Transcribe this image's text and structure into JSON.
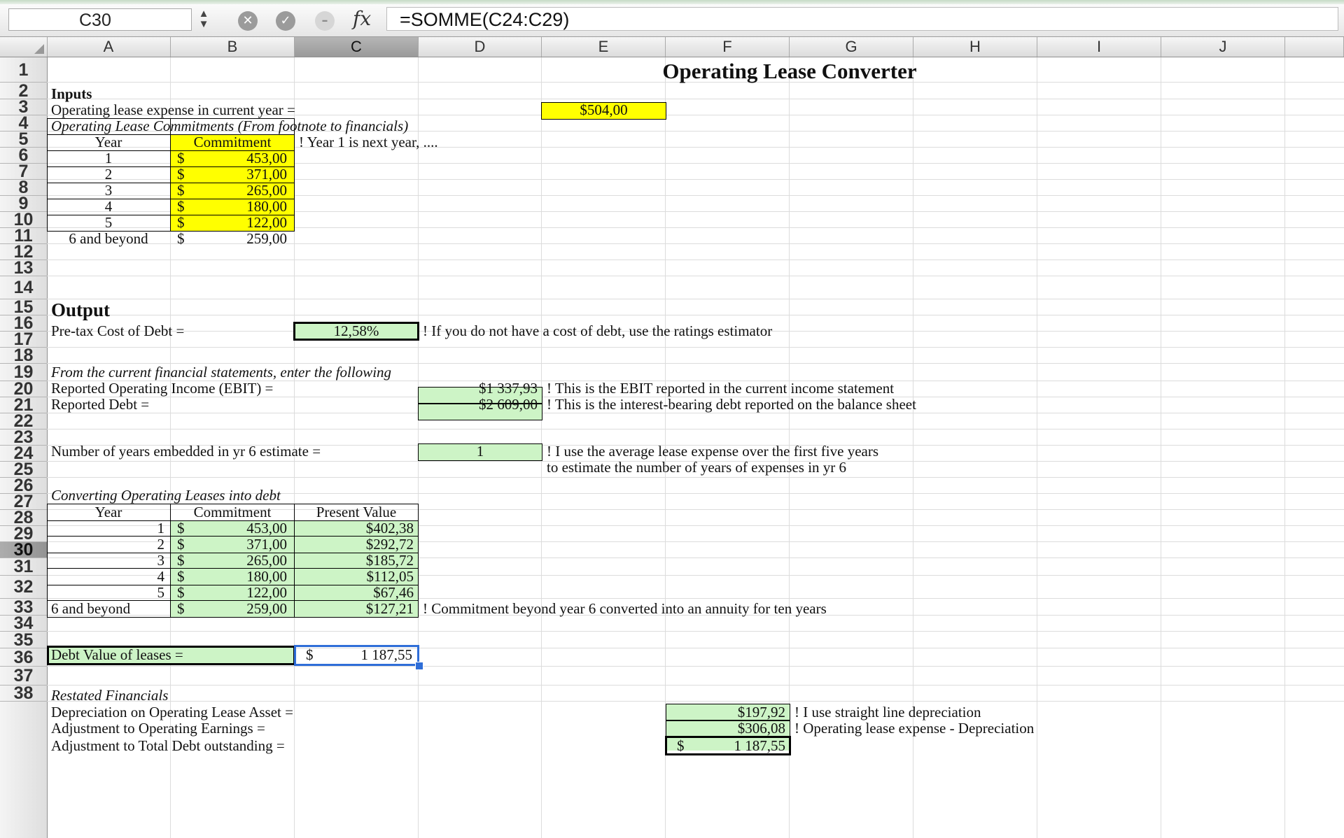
{
  "name_box": "C30",
  "stepper": {
    "up": "▲",
    "down": "▼"
  },
  "icons": {
    "cancel": "✕",
    "confirm": "✓",
    "gray": "–"
  },
  "fx_label": "fx",
  "formula": "=SOMME(C24:C29)",
  "columns": [
    "A",
    "B",
    "C",
    "D",
    "E",
    "F",
    "G",
    "H",
    "I",
    "J"
  ],
  "rows": [
    "1",
    "2",
    "3",
    "4",
    "5",
    "6",
    "7",
    "8",
    "9",
    "10",
    "11",
    "12",
    "13",
    "14",
    "15",
    "16",
    "17",
    "18",
    "19",
    "20",
    "21",
    "22",
    "23",
    "24",
    "25",
    "26",
    "27",
    "28",
    "29",
    "30",
    "31",
    "32",
    "33",
    "34",
    "35",
    "36",
    "37",
    "38"
  ],
  "selected_row": "30",
  "selected_col": "C",
  "sheet": {
    "title": "Operating Lease Converter",
    "inputs_label": "Inputs",
    "op_lease_label": "Operating lease expense in current year =",
    "op_lease_value": "$504,00",
    "commitments_label": "Operating Lease Commitments (From footnote to financials)",
    "year_hdr": "Year",
    "commitment_hdr": "Commitment",
    "pv_hdr": "Present Value",
    "year1_note": "! Year 1 is next year, ....",
    "dollar": "$",
    "inputs_table": [
      {
        "year": "1",
        "amount": "453,00"
      },
      {
        "year": "2",
        "amount": "371,00"
      },
      {
        "year": "3",
        "amount": "265,00"
      },
      {
        "year": "4",
        "amount": "180,00"
      },
      {
        "year": "5",
        "amount": "122,00"
      },
      {
        "year": "6 and beyond",
        "amount": "259,00"
      }
    ],
    "output_label": "Output",
    "pretax_label": "Pre-tax Cost of Debt =",
    "pretax_value": "12,58%",
    "pretax_note": "! If you do not have a cost of debt, use the ratings estimator",
    "current_fin_label": "From the current financial statements, enter the following",
    "ebit_label": "Reported Operating Income (EBIT) =",
    "ebit_value": "$1 337,93",
    "ebit_note": "! This is the EBIT reported in the current income statement",
    "debt_label": "Reported Debt =",
    "debt_value": "$2 609,00",
    "debt_note": "! This is the interest-bearing debt reported on the balance sheet",
    "years_label": "Number of years embedded in yr 6 estimate =",
    "years_value": "1",
    "years_note1": "! I use the average lease expense over the first five years",
    "years_note2": "to estimate the number of years of expenses in yr 6",
    "converting_label": "Converting Operating Leases into debt",
    "conv_table": [
      {
        "year": "1",
        "amount": "453,00",
        "pv": "$402,38"
      },
      {
        "year": "2",
        "amount": "371,00",
        "pv": "$292,72"
      },
      {
        "year": "3",
        "amount": "265,00",
        "pv": "$185,72"
      },
      {
        "year": "4",
        "amount": "180,00",
        "pv": "$112,05"
      },
      {
        "year": "5",
        "amount": "122,00",
        "pv": "$67,46"
      },
      {
        "year": "6 and beyond",
        "amount": "259,00",
        "pv": "$127,21"
      }
    ],
    "conv_note": "! Commitment beyond year 6 converted into an annuity for ten years",
    "debt_value_label": "Debt Value of leases =",
    "debt_value_amount": "1 187,55",
    "restated_label": "Restated Financials",
    "depr_label": "Depreciation on Operating Lease Asset =",
    "depr_value": "$197,92",
    "depr_note": "! I use straight line depreciation",
    "adj_earn_label": "Adjustment to Operating Earnings =",
    "adj_earn_value": "$306,08",
    "adj_earn_note": "! Operating lease expense - Depreciation",
    "adj_debt_label": "Adjustment to Total Debt outstanding =",
    "adj_debt_amount": "1 187,55"
  },
  "colors": {
    "input_fill": "#ffff00",
    "calc_fill": "#cdf4c6",
    "selection": "#2f6ed8"
  }
}
